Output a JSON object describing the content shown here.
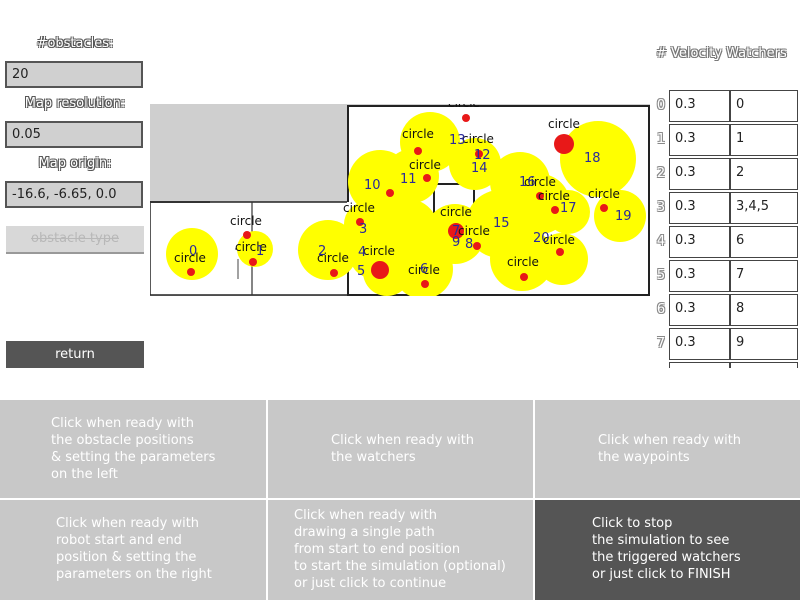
{
  "left_panel": {
    "obstacles_label": "#obstacles:",
    "obstacles_value": "20",
    "map_resolution_label": "Map resolution:",
    "map_resolution_value": "0.05",
    "map_origin_label": "Map origin:",
    "map_origin_value": "-16.6, -6.65, 0.0",
    "obstacle_type_label": "obstacle type",
    "return_label": "return"
  },
  "map": {
    "circle_label": "circle",
    "obstacle_color": "#ffff00",
    "robot_marker_color": "#e81818",
    "id_color": "#2a2a9a",
    "obstacle_ids": [
      "0",
      "1",
      "2",
      "3",
      "4",
      "5",
      "6",
      "7",
      "8",
      "9",
      "10",
      "11",
      "12",
      "13",
      "14",
      "15",
      "16",
      "17",
      "18",
      "19",
      "20"
    ]
  },
  "watchers": {
    "title": "# Velocity Watchers",
    "rows": [
      {
        "index": "0",
        "velocity": "0.3",
        "ids": "0"
      },
      {
        "index": "1",
        "velocity": "0.3",
        "ids": "1"
      },
      {
        "index": "2",
        "velocity": "0.3",
        "ids": "2"
      },
      {
        "index": "3",
        "velocity": "0.3",
        "ids": "3,4,5"
      },
      {
        "index": "4",
        "velocity": "0.3",
        "ids": "6"
      },
      {
        "index": "5",
        "velocity": "0.3",
        "ids": "7"
      },
      {
        "index": "6",
        "velocity": "0.3",
        "ids": "8"
      },
      {
        "index": "7",
        "velocity": "0.3",
        "ids": "9"
      },
      {
        "index": "8",
        "velocity": "",
        "ids": ""
      }
    ]
  },
  "steps": [
    "Click when ready with\nthe obstacle positions\n& setting the parameters\non the left",
    "Click when ready with\nthe watchers",
    "Click when ready with\nthe waypoints",
    "Click when ready with\nrobot start and end\nposition & setting the\nparameters on the right",
    "Click when ready with\ndrawing a single path\nfrom start to end position\nto start the simulation (optional)\nor just click to continue",
    "Click to stop\nthe simulation to see\nthe triggered watchers\nor just click to FINISH"
  ],
  "colors": {
    "step_bg": "#c8c8c8",
    "step_active_bg": "#555555",
    "button_bg": "#555555"
  }
}
